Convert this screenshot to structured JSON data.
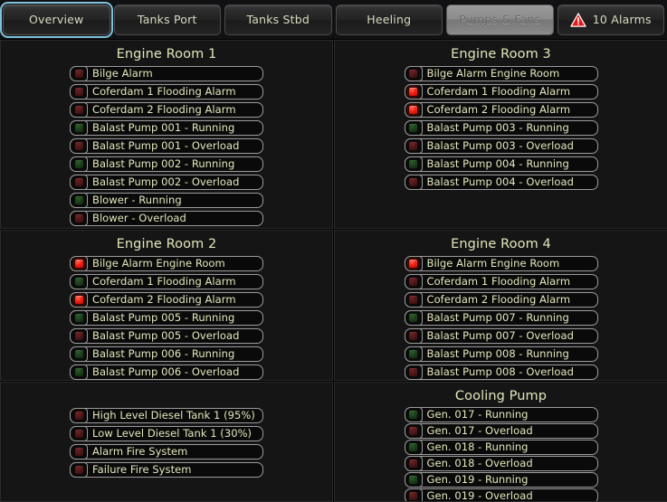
{
  "tabs": [
    {
      "label": "Overview",
      "state": "active",
      "name": "tab-overview"
    },
    {
      "label": "Tanks Port",
      "state": "normal",
      "name": "tab-tanks-port"
    },
    {
      "label": "Tanks Stbd",
      "state": "normal",
      "name": "tab-tanks-stbd"
    },
    {
      "label": "Heeling",
      "state": "normal",
      "name": "tab-heeling"
    },
    {
      "label": "Pumps & Fans",
      "state": "disabled",
      "name": "tab-pumps-fans"
    }
  ],
  "alarm_tab": {
    "label": "10 Alarms",
    "count": 10,
    "icon": "warning-triangle-icon",
    "icon_color": "#e01c1c"
  },
  "colors": {
    "accent_focus": "#7fc3dd",
    "text": "#e4e7bc",
    "panel_bg": "#151515",
    "led_red_on": "#f21d10",
    "led_red_off": "#4e1818",
    "led_green_on": "#19d419",
    "led_green_off": "#1d3f1d",
    "alarm_red": "#e01c1c"
  },
  "panels": [
    {
      "id": "engine-room-1",
      "title": "Engine Room 1",
      "compact": false,
      "rows": [
        {
          "led": "red-off",
          "label": "Bilge Alarm"
        },
        {
          "led": "red-off",
          "label": "Coferdam 1 Flooding Alarm"
        },
        {
          "led": "red-off",
          "label": "Coferdam 2 Flooding Alarm"
        },
        {
          "led": "green-off",
          "label": "Balast Pump 001 - Running"
        },
        {
          "led": "red-off",
          "label": "Balast Pump 001 - Overload"
        },
        {
          "led": "green-off",
          "label": "Balast Pump 002 - Running"
        },
        {
          "led": "red-off",
          "label": "Balast Pump 002 - Overload"
        },
        {
          "led": "green-off",
          "label": "Blower - Running"
        },
        {
          "led": "red-off",
          "label": "Blower - Overload"
        }
      ]
    },
    {
      "id": "engine-room-3",
      "title": "Engine Room 3",
      "compact": false,
      "rows": [
        {
          "led": "red-off",
          "label": "Bilge Alarm Engine Room"
        },
        {
          "led": "red-on",
          "label": "Coferdam 1 Flooding Alarm"
        },
        {
          "led": "red-on",
          "label": "Coferdam 2 Flooding Alarm"
        },
        {
          "led": "green-off",
          "label": "Balast Pump 003 - Running"
        },
        {
          "led": "red-off",
          "label": "Balast Pump 003 - Overload"
        },
        {
          "led": "green-off",
          "label": "Balast Pump 004 - Running"
        },
        {
          "led": "red-off",
          "label": "Balast Pump 004 - Overload"
        }
      ]
    },
    {
      "id": "engine-room-2",
      "title": "Engine Room 2",
      "compact": false,
      "rows": [
        {
          "led": "red-on",
          "label": "Bilge Alarm Engine Room"
        },
        {
          "led": "green-off",
          "label": "Coferdam 1 Flooding Alarm"
        },
        {
          "led": "red-on",
          "label": "Coferdam 2 Flooding Alarm"
        },
        {
          "led": "green-off",
          "label": "Balast Pump 005 - Running"
        },
        {
          "led": "red-off",
          "label": "Balast Pump 005 - Overload"
        },
        {
          "led": "green-off",
          "label": "Balast Pump 006 - Running"
        },
        {
          "led": "green-off",
          "label": "Balast Pump 006 - Overload"
        }
      ]
    },
    {
      "id": "engine-room-4",
      "title": "Engine Room 4",
      "compact": false,
      "rows": [
        {
          "led": "red-on",
          "label": "Bilge Alarm Engine Room"
        },
        {
          "led": "red-off",
          "label": "Coferdam 1 Flooding Alarm"
        },
        {
          "led": "red-off",
          "label": "Coferdam 2 Flooding Alarm"
        },
        {
          "led": "green-off",
          "label": "Balast Pump 007 - Running"
        },
        {
          "led": "red-off",
          "label": "Balast Pump 007 - Overload"
        },
        {
          "led": "green-off",
          "label": "Balast Pump 008 - Running"
        },
        {
          "led": "red-off",
          "label": "Balast Pump 008 - Overload"
        }
      ]
    },
    {
      "id": "diesel-fire",
      "title": "",
      "compact": false,
      "rows": [
        {
          "led": "red-off",
          "label": "High Level Diesel Tank 1 (95%)"
        },
        {
          "led": "red-off",
          "label": "Low Level Diesel Tank 1 (30%)"
        },
        {
          "led": "red-off",
          "label": "Alarm Fire System"
        },
        {
          "led": "red-off",
          "label": "Failure Fire System"
        }
      ]
    },
    {
      "id": "cooling-pump",
      "title": "Cooling Pump",
      "compact": true,
      "rows": [
        {
          "led": "green-off",
          "label": "Gen. 017 - Running"
        },
        {
          "led": "red-off",
          "label": "Gen. 017 - Overload"
        },
        {
          "led": "green-off",
          "label": "Gen. 018 - Running"
        },
        {
          "led": "red-off",
          "label": "Gen. 018 - Overload"
        },
        {
          "led": "green-off",
          "label": "Gen. 019 - Running"
        },
        {
          "led": "red-off",
          "label": "Gen. 019 - Overload"
        }
      ]
    }
  ]
}
